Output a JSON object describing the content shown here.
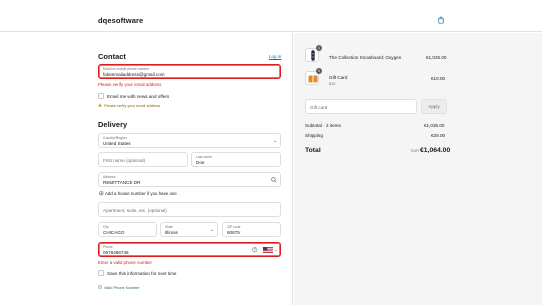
{
  "header": {
    "brand": "dqesoftware",
    "bag_icon": "shopping-bag-icon"
  },
  "contact": {
    "title": "Contact",
    "login_link": "Log in",
    "email_label": "Email or mobile phone number",
    "email_value": "fakeemailaddress@gmail.com",
    "email_error": "Please verify your email address",
    "news_label": "Email me with news and offers",
    "warning_text": "Please verify your email address"
  },
  "delivery": {
    "title": "Delivery",
    "country_label": "Country/Region",
    "country_value": "United States",
    "first_name_placeholder": "First name (optional)",
    "last_name_label": "Last name",
    "last_name_value": "Doe",
    "address_label": "Address",
    "address_value": "REMITTANCE DR",
    "house_number_hint": "Add a house number if you have one",
    "apartment_placeholder": "Apartment, suite, etc. (optional)",
    "city_label": "City",
    "city_value": "CHICAGO",
    "state_label": "State",
    "state_value": "Illinois",
    "zip_label": "ZIP code",
    "zip_value": "60675",
    "phone_label": "Phone",
    "phone_value": "0678486746",
    "phone_error": "Enter a valid phone number",
    "save_info_label": "Save this information for next time",
    "valid_phone_label": "Valid Phone Number",
    "error_color": "#dd1d1d",
    "accent_color": "#1773b0"
  },
  "summary": {
    "items": [
      {
        "name": "The Collection Snowboard: Oxygen",
        "sub": "",
        "qty": "1",
        "price": "€1,025.00"
      },
      {
        "name": "Gift Card",
        "sub": "$10",
        "qty": "1",
        "price": "€10.00"
      }
    ],
    "gift_placeholder": "Gift card",
    "apply_label": "Apply",
    "subtotal_label": "Subtotal · 2 items",
    "subtotal_value": "€1,035.00",
    "shipping_label": "Shipping",
    "shipping_value": "€29.00",
    "total_label": "Total",
    "currency": "EUR",
    "total_value": "€1,064.00"
  }
}
